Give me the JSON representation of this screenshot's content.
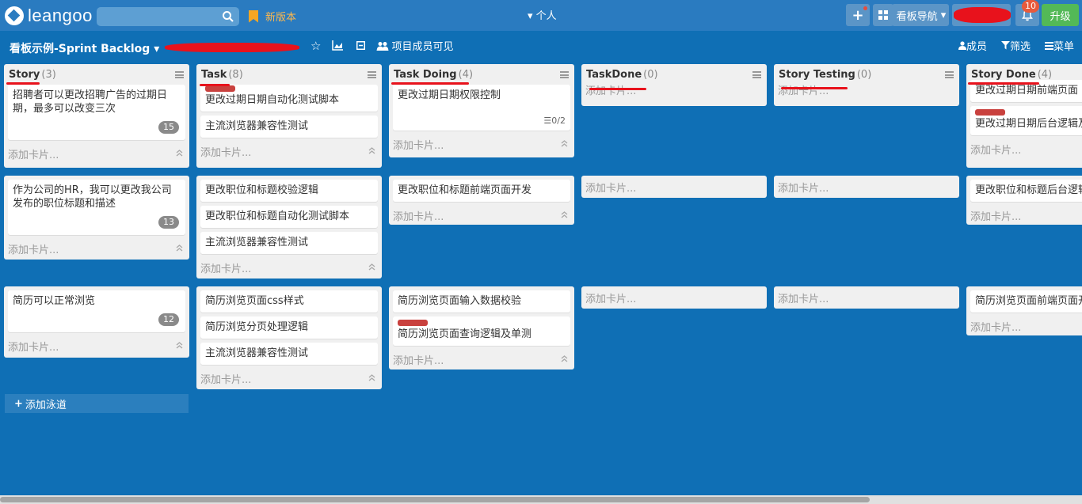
{
  "topbar": {
    "logo_text": "leangoo",
    "new_version": "新版本",
    "personal": "个人",
    "add_icon": "+",
    "nav_label": "看板导航",
    "notification_count": "10",
    "upgrade": "升级"
  },
  "board": {
    "title": "看板示例-Sprint Backlog",
    "visibility": "项目成员可见",
    "members": "成员",
    "filter": "筛选",
    "menu": "菜单"
  },
  "add_card_label": "添加卡片...",
  "add_lane_label": "添加泳道",
  "columns": [
    {
      "name": "Story",
      "count": "(3)"
    },
    {
      "name": "Task",
      "count": "(8)"
    },
    {
      "name": "Task Doing",
      "count": "(4)"
    },
    {
      "name": "TaskDone",
      "count": "(0)"
    },
    {
      "name": "Story Testing",
      "count": "(0)"
    },
    {
      "name": "Story Done",
      "count": "(4)"
    }
  ],
  "lanes": [
    {
      "story": {
        "text": "招聘者可以更改招聘广告的过期日期，最多可以改变三次",
        "badge": "15"
      },
      "task": [
        "更改过期日期自动化测试脚本",
        "主流浏览器兼容性测试"
      ],
      "doing": [
        {
          "text": "更改过期日期权限控制",
          "checklist": "0/2"
        }
      ],
      "done_story": [
        "更改过期日期前端页面",
        "更改过期日期后台逻辑及"
      ]
    },
    {
      "story": {
        "text": "作为公司的HR，我可以更改我公司发布的职位标题和描述",
        "badge": "13"
      },
      "task": [
        "更改职位和标题校验逻辑",
        "更改职位和标题自动化测试脚本",
        "主流浏览器兼容性测试"
      ],
      "doing": [
        {
          "text": "更改职位和标题前端页面开发"
        }
      ],
      "done_story": [
        "更改职位和标题后台逻辑"
      ]
    },
    {
      "story": {
        "text": "简历可以正常浏览",
        "badge": "12"
      },
      "task": [
        "简历浏览页面css样式",
        "简历浏览分页处理逻辑",
        "主流浏览器兼容性测试"
      ],
      "doing": [
        {
          "text": "简历浏览页面输入数据校验"
        },
        {
          "text": "简历浏览页面查询逻辑及单测"
        }
      ],
      "done_story": [
        "简历浏览页面前端页面开"
      ]
    }
  ]
}
